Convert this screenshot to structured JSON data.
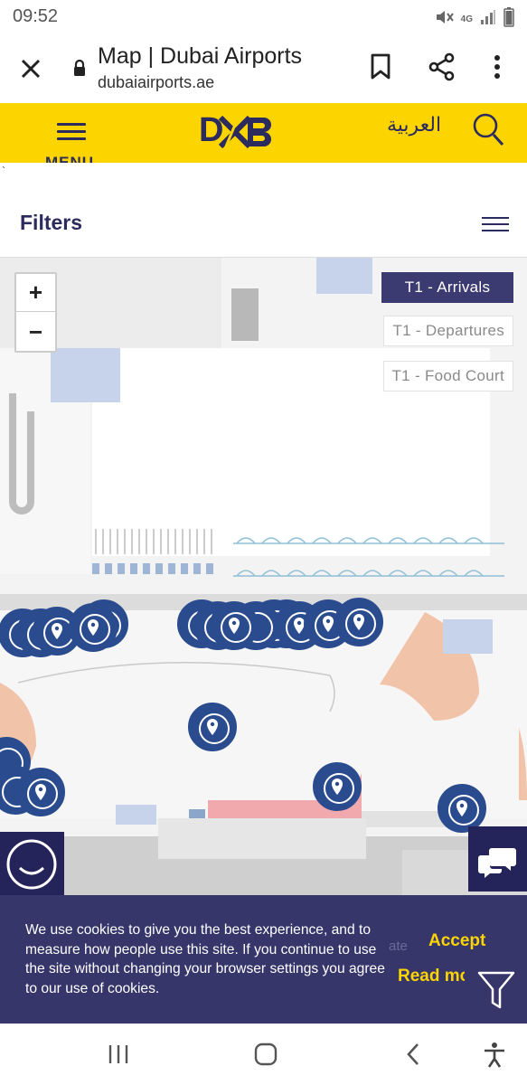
{
  "status_bar": {
    "time": "09:52",
    "network": "4G",
    "icons": [
      "mute-icon",
      "signal-icon",
      "battery-icon"
    ]
  },
  "browser": {
    "title": "Map | Dubai Airports",
    "url": "dubaiairports.ae",
    "icons": [
      "close-icon",
      "lock-icon",
      "bookmark-icon",
      "share-icon",
      "more-icon"
    ]
  },
  "header": {
    "menu_label": "MENU",
    "logo_text": "DXB",
    "language_link": "العربية",
    "background_color": "#fcd400",
    "icons": [
      "hamburger-icon",
      "search-icon"
    ]
  },
  "stray_mark": "`",
  "filters": {
    "label": "Filters"
  },
  "map": {
    "zoom_in": "+",
    "zoom_out": "−",
    "layers": [
      {
        "label": "T1 - Arrivals",
        "active": true
      },
      {
        "label": "T1 - Departures",
        "active": false
      },
      {
        "label": "T1 - Food Court",
        "active": false
      }
    ],
    "pin_color": "#2a4c8e"
  },
  "cookie_banner": {
    "text": "We use cookies to give you the best experience, and to measure how people use this site. If you continue to use the site without changing your browser settings you agree to our use of cookies.",
    "faded_background_text": "ate",
    "accept_label": "Accept",
    "read_more_label": "Read more",
    "accent_color": "#fcd400"
  },
  "nav_bar": {
    "icons": [
      "recent-apps-icon",
      "home-icon",
      "back-icon",
      "accessibility-icon"
    ]
  }
}
